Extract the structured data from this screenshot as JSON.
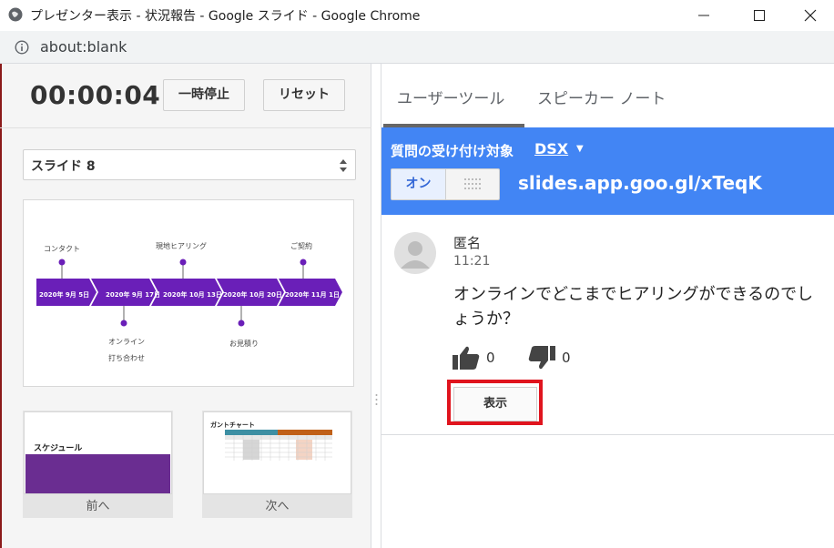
{
  "window": {
    "title": "プレゼンター表示 - 状況報告 - Google スライド - Google Chrome",
    "url": "about:blank"
  },
  "controls": {
    "timer": "00:00:04",
    "pause_label": "一時停止",
    "reset_label": "リセット",
    "slide_select": "スライド 8"
  },
  "current_slide": {
    "labels_top": [
      "コンタクト",
      "現地ヒアリング",
      "ご契約"
    ],
    "labels_bottom": [
      "オンライン",
      "打ち合わせ",
      "お見積り"
    ],
    "dates": [
      "2020年 9月 5日",
      "2020年 9月 17日",
      "2020年 10月 13日",
      "2020年 10月 20日",
      "2020年 11月 1日"
    ],
    "accent_color": "#6a1fb8"
  },
  "thumbnails": {
    "prev": {
      "title": "スケジュール",
      "caption": "前へ"
    },
    "next": {
      "title": "ガントチャート",
      "caption": "次へ"
    }
  },
  "tabs": {
    "audience": "ユーザーツール",
    "notes": "スピーカー ノート"
  },
  "qa": {
    "accepting_label": "質問の受け付け対象",
    "audience_name": "DSX",
    "toggle_on": "オン",
    "link": "slides.app.goo.gl/xTeqK",
    "bar_color": "#4285f4"
  },
  "question": {
    "author": "匿名",
    "time": "11:21",
    "text": "オンラインでどこまでヒアリングができるのでしょうか？",
    "likes": "0",
    "dislikes": "0",
    "show_label": "表示"
  }
}
